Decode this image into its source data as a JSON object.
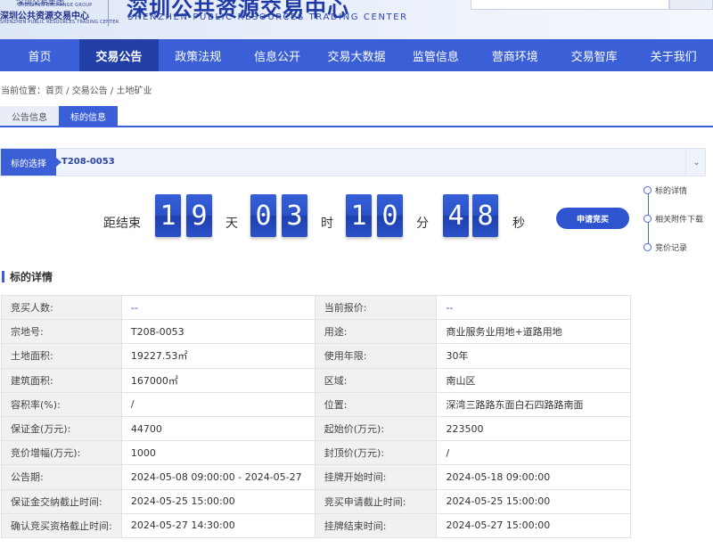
{
  "header": {
    "logo_small_line1": "深圳交易集团",
    "logo_small_line2": "SHENZHEN EXCHANGE GROUP",
    "logo_small_line3": "深圳公共资源交易中心",
    "logo_small_line4": "SHENZHEN PUBLIC RESOURCES TRADING CENTER",
    "logo_cn": "深圳公共资源交易中心",
    "logo_en": "SHENZHEN PUBLIC RESOURCES TRADING CENTER"
  },
  "nav": [
    "首页",
    "交易公告",
    "政策法规",
    "信息公开",
    "交易大数据",
    "监管信息",
    "营商环境",
    "交易智库",
    "关于我们"
  ],
  "breadcrumb": "当前位置：首页 / 交易公告 / 土地矿业",
  "tabs": [
    "公告信息",
    "标的信息"
  ],
  "selector": {
    "label": "标的选择",
    "value": "T208-0053",
    "caret": "⌄"
  },
  "countdown": {
    "prefix": "距结束",
    "days": [
      "1",
      "9"
    ],
    "day_unit": "天",
    "hours": [
      "0",
      "3"
    ],
    "hour_unit": "时",
    "minutes": [
      "1",
      "0"
    ],
    "minute_unit": "分",
    "seconds": [
      "4",
      "8"
    ],
    "second_unit": "秒"
  },
  "apply_button": "申请竞买",
  "side_nav": [
    "标的详情",
    "相关附件下载",
    "竞价记录"
  ],
  "section_title": "标的详情",
  "detail_rows": [
    [
      "竞买人数:",
      "--",
      "当前报价:",
      "--"
    ],
    [
      "宗地号:",
      "T208-0053",
      "用途:",
      "商业服务业用地+道路用地"
    ],
    [
      "土地面积:",
      "19227.53㎡",
      "使用年限:",
      "30年"
    ],
    [
      "建筑面积:",
      "167000㎡",
      "区域:",
      "南山区"
    ],
    [
      "容积率(%):",
      "/",
      "位置:",
      "深湾三路路东面白石四路路南面"
    ],
    [
      "保证金(万元):",
      "44700",
      "起始价(万元):",
      "223500"
    ],
    [
      "竞价增幅(万元):",
      "1000",
      "封顶价(万元):",
      "/"
    ],
    [
      "公告期:",
      "2024-05-08 09:00:00 - 2024-05-27",
      "挂牌开始时间:",
      "2024-05-18 09:00:00"
    ],
    [
      "保证金交纳截止时间:",
      "2024-05-25 15:00:00",
      "竞买申请截止时间:",
      "2024-05-25 15:00:00"
    ],
    [
      "确认竞买资格截止时间:",
      "2024-05-27 14:30:00",
      "挂牌结束时间:",
      "2024-05-27 15:00:00"
    ]
  ],
  "colors": {
    "nav_bg": "#3a5fd6",
    "nav_active": "#213fa6",
    "accent": "#2e55cf"
  }
}
